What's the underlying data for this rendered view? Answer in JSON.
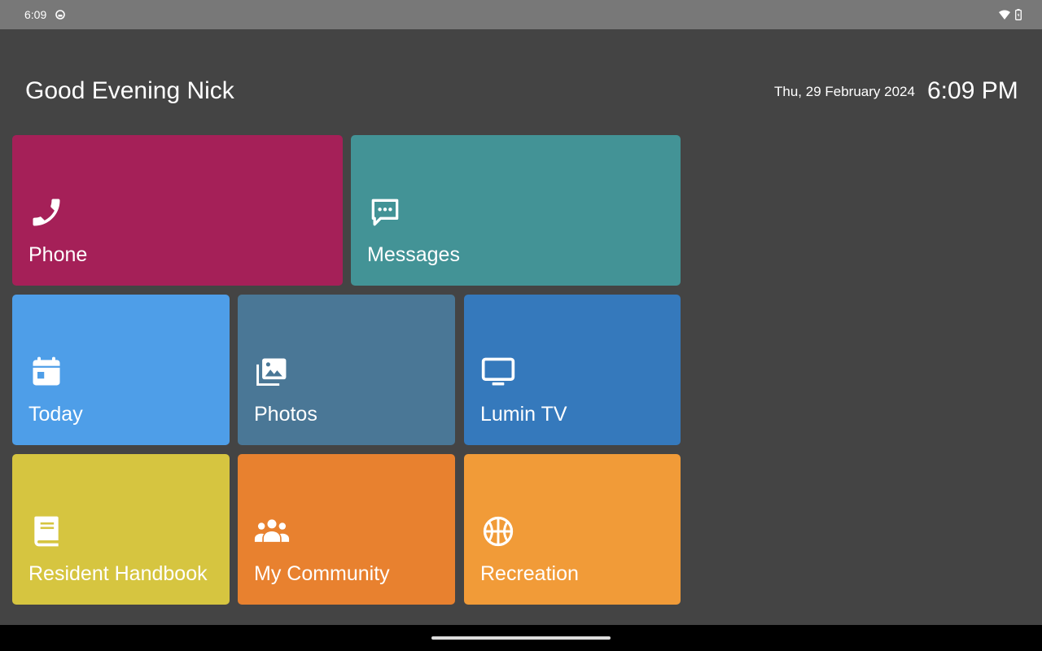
{
  "status_bar": {
    "time": "6:09",
    "icons": [
      "app-notification-icon",
      "wifi-icon",
      "battery-icon"
    ]
  },
  "header": {
    "greeting": "Good Evening Nick",
    "date": "Thu, 29 February 2024",
    "time": "6:09 PM"
  },
  "tiles": [
    {
      "label": "Phone",
      "icon": "phone-icon",
      "color": "#A52058"
    },
    {
      "label": "Messages",
      "icon": "chat-bubble-icon",
      "color": "#439396"
    },
    {
      "label": "Today",
      "icon": "calendar-icon",
      "color": "#4E9EE8"
    },
    {
      "label": "Photos",
      "icon": "photo-library-icon",
      "color": "#4A7796"
    },
    {
      "label": "Lumin TV",
      "icon": "tv-icon",
      "color": "#3579BC"
    },
    {
      "label": "Resident Handbook",
      "icon": "book-icon",
      "color": "#D6C540"
    },
    {
      "label": "My Community",
      "icon": "group-icon",
      "color": "#E8812F"
    },
    {
      "label": "Recreation",
      "icon": "basketball-icon",
      "color": "#F19B38"
    }
  ],
  "colors": {
    "background": "#444444",
    "status_bar": "#787878",
    "nav_bar": "#000000"
  }
}
